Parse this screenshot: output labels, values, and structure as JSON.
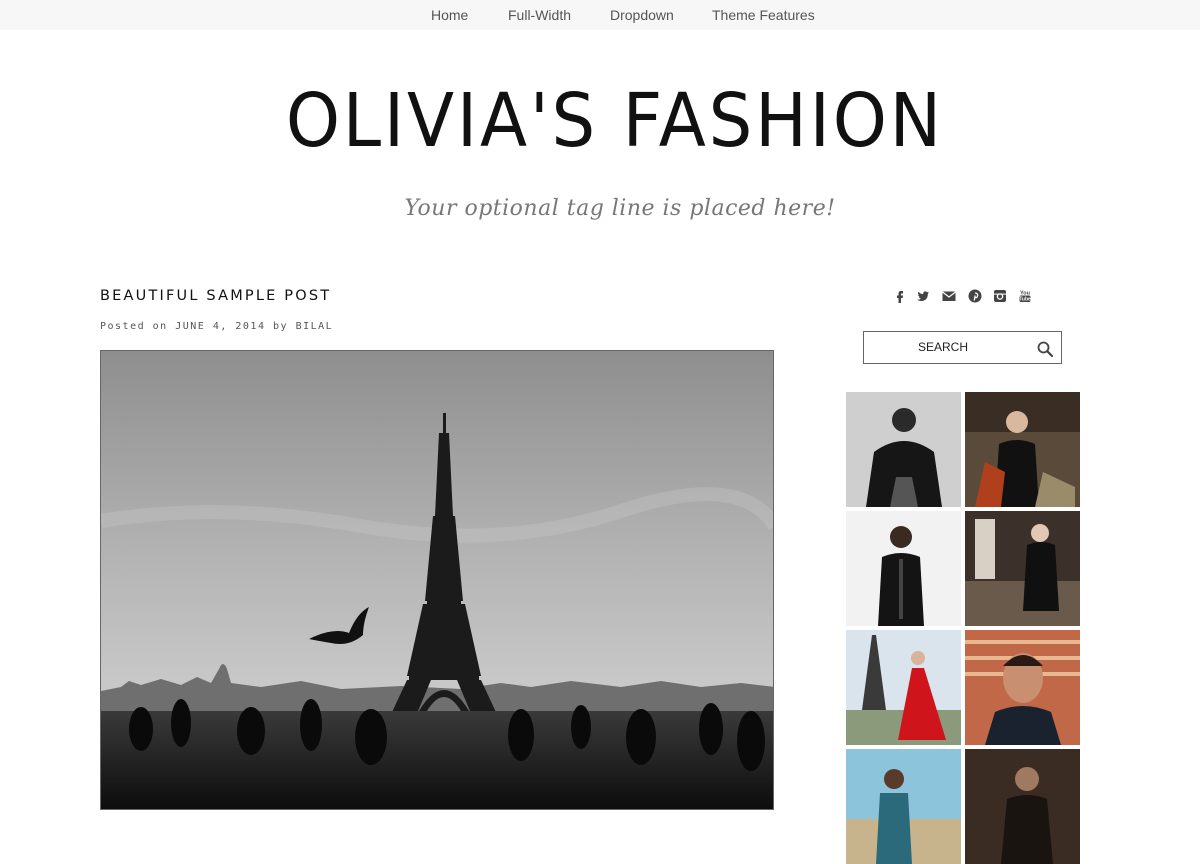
{
  "nav": {
    "items": [
      {
        "label": "Home"
      },
      {
        "label": "Full-Width"
      },
      {
        "label": "Dropdown"
      },
      {
        "label": "Theme Features"
      }
    ]
  },
  "header": {
    "title": "OLIVIA'S FASHION",
    "tagline": "Your optional tag line is placed here!"
  },
  "post": {
    "title": "BEAUTIFUL SAMPLE POST",
    "meta_prefix": "Posted on ",
    "date": "JUNE 4, 2014",
    "meta_by": " by ",
    "author": "BILAL"
  },
  "sidebar": {
    "social_icons": [
      "facebook-icon",
      "twitter-icon",
      "email-icon",
      "pinterest-icon",
      "instagram-icon",
      "youtube-icon"
    ],
    "search": {
      "placeholder": "SEARCH"
    },
    "gallery_icons": [
      "fur-coat-model",
      "black-dress-model",
      "black-jacket-model",
      "interior-model",
      "eiffel-red-dress-model",
      "portrait-man",
      "blue-sky-model",
      "dark-portrait-man"
    ]
  },
  "colors": {
    "nav_bg": "#f7f7f7",
    "text": "#111111",
    "meta": "#555555",
    "tagline": "#777777"
  }
}
